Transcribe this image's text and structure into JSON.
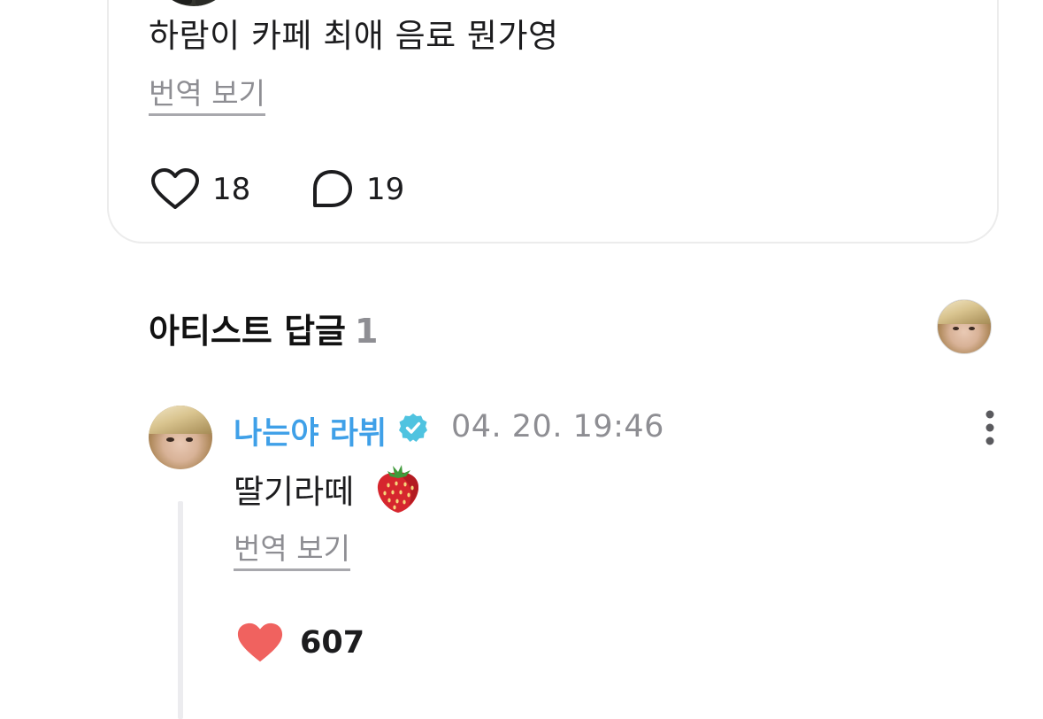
{
  "post": {
    "text": "하람이 카페 최애 음료 뭔가영",
    "translate_label": "번역 보기",
    "like_count": "18",
    "comment_count": "19"
  },
  "artist_replies": {
    "title": "아티스트 답글",
    "count": "1"
  },
  "reply": {
    "author": "나는야 라뷔",
    "timestamp": "04. 20. 19:46",
    "text": "딸기라떼",
    "translate_label": "번역 보기",
    "like_count": "607"
  },
  "colors": {
    "author_accent": "#3fa0e8",
    "liked_heart": "#f0625f",
    "verified_badge": "#4fc3e0"
  },
  "icons": [
    "heart-outline-icon",
    "comment-bubble-icon",
    "verified-badge-icon",
    "more-vertical-icon",
    "strawberry-emoji-icon",
    "heart-filled-icon"
  ]
}
